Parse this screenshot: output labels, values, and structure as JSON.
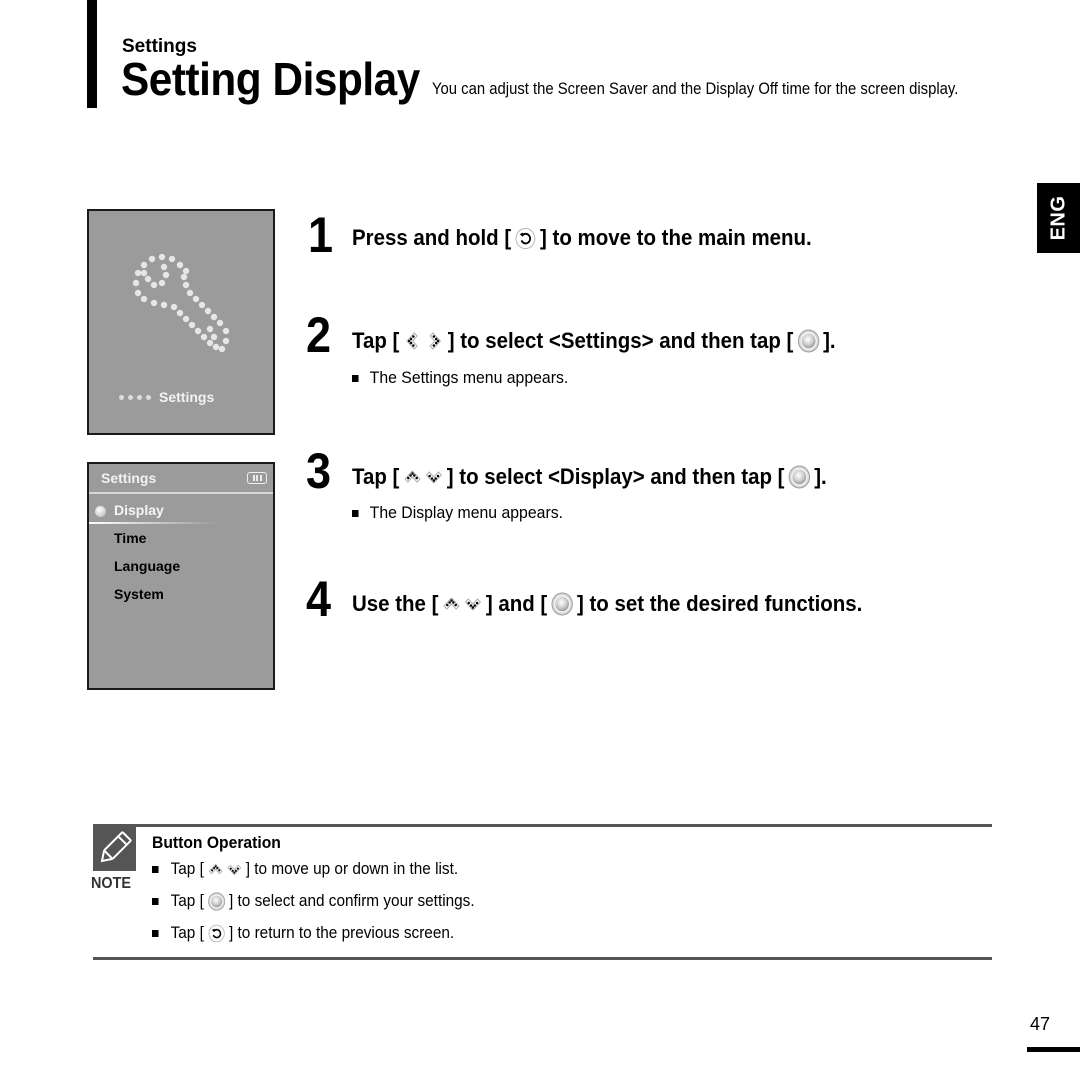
{
  "header": {
    "section": "Settings",
    "title": "Setting Display",
    "description": "You can adjust the Screen Saver and the Display Off time for the screen display."
  },
  "language_tab": "ENG",
  "device_screens": {
    "main_menu": {
      "icon": "wrench-icon",
      "label": "Settings"
    },
    "settings_menu": {
      "title": "Settings",
      "battery_icon": "battery-icon",
      "items": [
        {
          "label": "Display",
          "selected": true
        },
        {
          "label": "Time",
          "selected": false
        },
        {
          "label": "Language",
          "selected": false
        },
        {
          "label": "System",
          "selected": false
        }
      ]
    }
  },
  "steps": [
    {
      "number": "1",
      "parts": [
        "Press and hold [",
        "] to move to the main menu."
      ],
      "icons": [
        "back-icon"
      ],
      "sub": null
    },
    {
      "number": "2",
      "parts": [
        "Tap [",
        "] to select <Settings> and then tap [",
        "]."
      ],
      "icons": [
        "left-right-icon",
        "select-button-icon"
      ],
      "sub": "The Settings menu appears."
    },
    {
      "number": "3",
      "parts": [
        "Tap [",
        "] to select <Display> and then tap [",
        "]."
      ],
      "icons": [
        "up-down-icon",
        "select-button-icon"
      ],
      "sub": "The Display menu appears."
    },
    {
      "number": "4",
      "parts": [
        "Use the [",
        "] and [",
        "] to set the desired functions."
      ],
      "icons": [
        "up-down-icon",
        "select-button-icon"
      ],
      "sub": null
    }
  ],
  "note": {
    "label": "NOTE",
    "title": "Button Operation",
    "items": [
      {
        "parts": [
          "Tap [",
          "] to move up or down in the list."
        ],
        "icon": "up-down-icon"
      },
      {
        "parts": [
          "Tap [",
          "] to select and confirm your settings."
        ],
        "icon": "select-button-icon"
      },
      {
        "parts": [
          "Tap [",
          "] to return to the previous screen."
        ],
        "icon": "back-icon"
      }
    ]
  },
  "page_number": "47"
}
